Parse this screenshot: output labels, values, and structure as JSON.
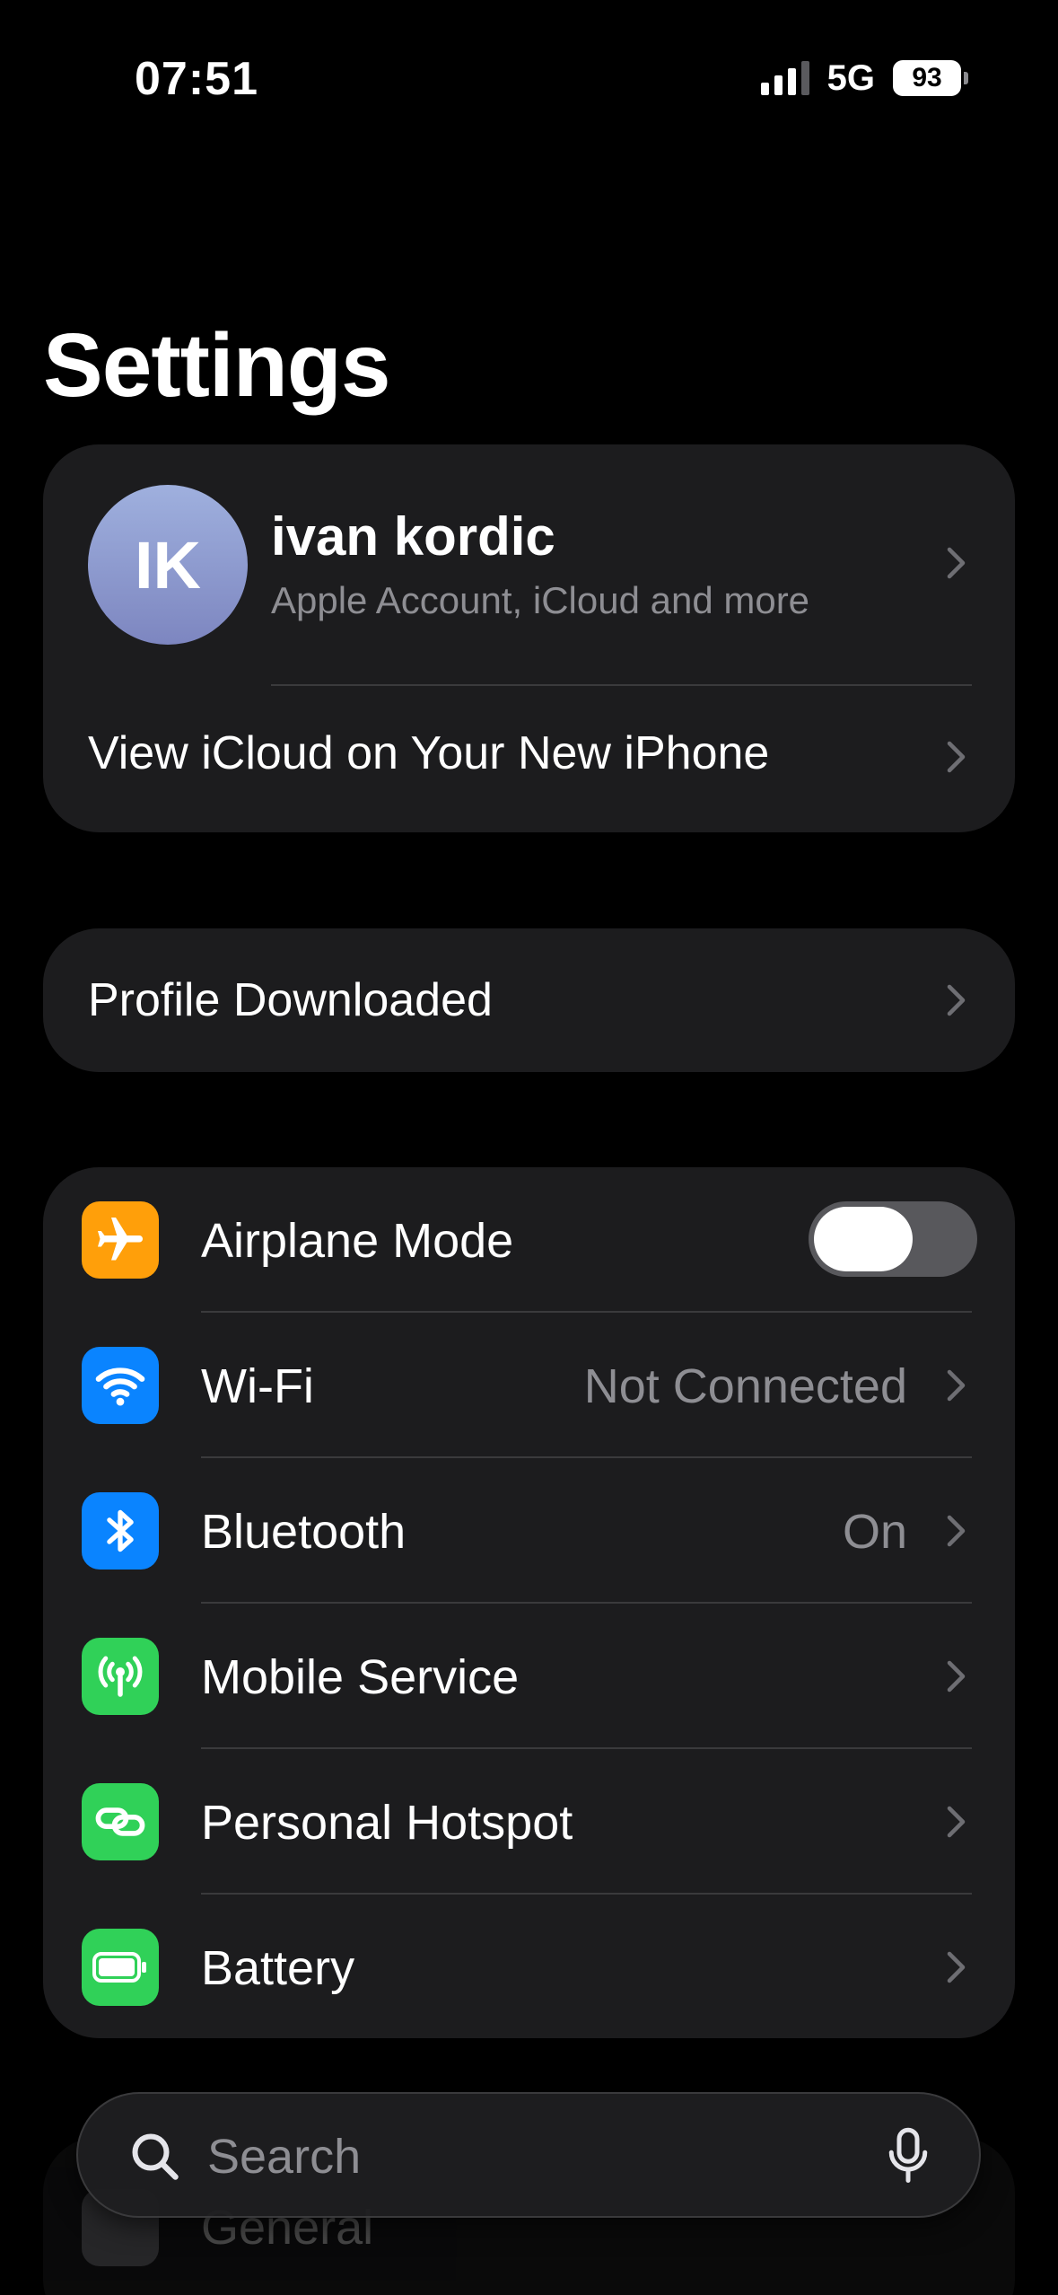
{
  "status_bar": {
    "time": "07:51",
    "network": "5G",
    "battery": "93"
  },
  "title": "Settings",
  "account": {
    "initials": "IK",
    "name": "ivan kordic",
    "subtitle": "Apple Account, iCloud and more",
    "icloud_link": "View iCloud on Your New iPhone"
  },
  "profile": {
    "label": "Profile Downloaded"
  },
  "settings": {
    "items": [
      {
        "label": "Airplane Mode",
        "icon": "airplane-icon",
        "color": "#ff9f0a",
        "toggle": false
      },
      {
        "label": "Wi-Fi",
        "icon": "wifi-icon",
        "color": "#0a84ff",
        "value": "Not Connected"
      },
      {
        "label": "Bluetooth",
        "icon": "bluetooth-icon",
        "color": "#0a84ff",
        "value": "On"
      },
      {
        "label": "Mobile Service",
        "icon": "antenna-icon",
        "color": "#30d158"
      },
      {
        "label": "Personal Hotspot",
        "icon": "hotspot-link-icon",
        "color": "#30d158"
      },
      {
        "label": "Battery",
        "icon": "battery-icon",
        "color": "#30d158"
      }
    ]
  },
  "ghost_row": {
    "label": "General",
    "icon": "gear-icon"
  },
  "search": {
    "placeholder": "Search"
  }
}
